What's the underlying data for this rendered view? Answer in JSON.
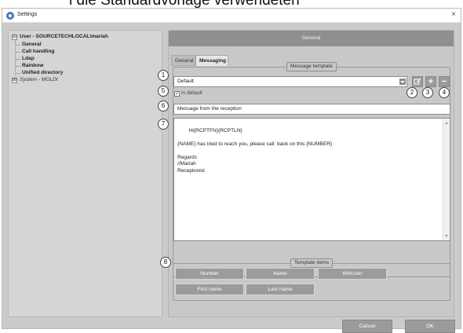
{
  "caption": "l die Standardvorlage verwendeten",
  "window": {
    "title": "Settings",
    "close_label": "×"
  },
  "tree": {
    "user_node": "User - SOURCETECHLOCAL\\mariah",
    "user_expander": "⊟",
    "items": [
      "General",
      "Call handling",
      "Ldap",
      "Rainbow",
      "Unified directory"
    ],
    "system_node": "System - MOLDI",
    "system_expander": "⊞"
  },
  "panel": {
    "header": "General",
    "tabs": [
      "General",
      "Messaging"
    ],
    "active_tab": "Messaging",
    "message_template_label": "Message template",
    "template_select_value": "Default",
    "is_default_label": "Is default",
    "is_default_checked": true,
    "subject_value": "Message from the reception",
    "body_value": "Hi{RCPTFN}{RCPTLN}\n\n{NAME} has tried to reach you, please call  back on this {NUMBER}\n\nRegards\n//Mariah\nReceptonist",
    "template_items_label": "Template items",
    "template_items": [
      "Number",
      "Name",
      "WinUser",
      "First name",
      "Last name"
    ],
    "buttons": {
      "edit_icon": "edit-icon",
      "add_label": "+",
      "remove_label": "−"
    }
  },
  "markers": [
    "1",
    "2",
    "3",
    "4",
    "5",
    "6",
    "7",
    "8"
  ],
  "footer": {
    "cancel_label": "Cancel",
    "ok_label": "OK"
  },
  "colors": {
    "panel_header": "#8f8f8f",
    "button_gray": "#9b9b9b",
    "body_bg": "#cbcbcb"
  }
}
